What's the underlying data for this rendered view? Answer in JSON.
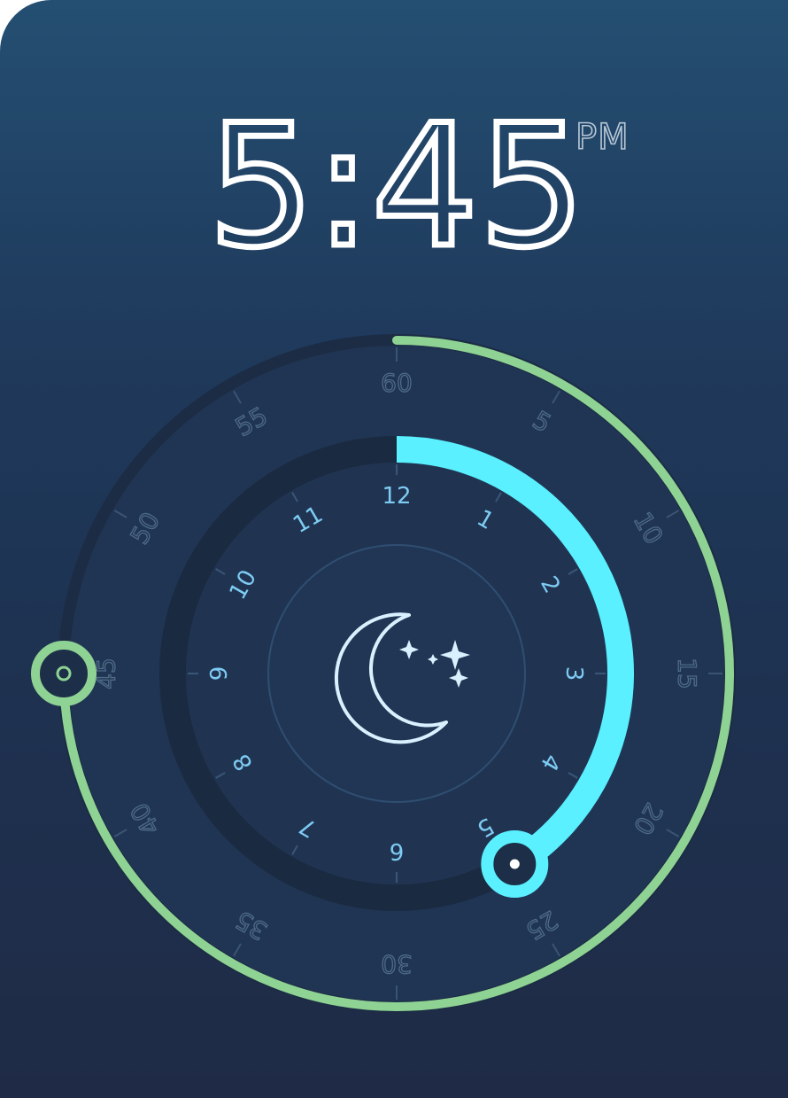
{
  "time": {
    "hours": "5",
    "separator": ":",
    "minutes": "45",
    "ampm": "PM"
  },
  "minute_ring": {
    "labels": [
      "60",
      "5",
      "10",
      "15",
      "20",
      "25",
      "30",
      "35",
      "40",
      "45",
      "50",
      "55"
    ],
    "selected_minute": 45,
    "color": "#8fd394",
    "label_color": "#4e6b86"
  },
  "hour_ring": {
    "labels": [
      "12",
      "1",
      "2",
      "3",
      "4",
      "5",
      "6",
      "7",
      "8",
      "9",
      "10",
      "11"
    ],
    "selected_hour": 5,
    "color": "#5af0ff",
    "label_color": "#7ecbf3"
  },
  "center": {
    "icon": "moon-stars-icon",
    "icon_color": "#d9f1ff"
  }
}
